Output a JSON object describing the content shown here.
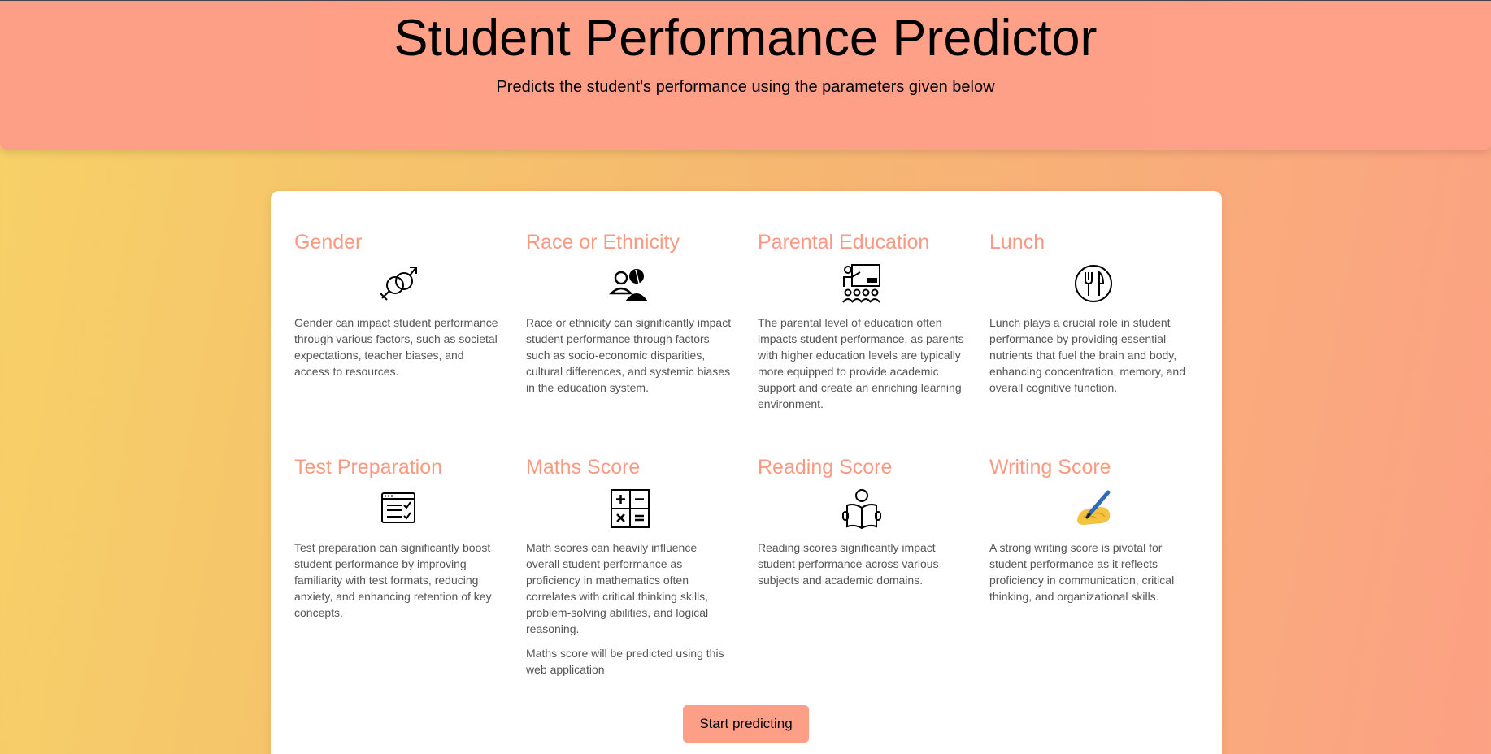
{
  "header": {
    "title": "Student Performance Predictor",
    "subtitle": "Predicts the student's performance using the parameters given below"
  },
  "features": [
    {
      "title": "Gender",
      "icon": "gender-icon",
      "description": "Gender can impact student performance through various factors, such as societal expectations, teacher biases, and access to resources."
    },
    {
      "title": "Race or Ethnicity",
      "icon": "ethnicity-icon",
      "description": "Race or ethnicity can significantly impact student performance through factors such as socio-economic disparities, cultural differences, and systemic biases in the education system."
    },
    {
      "title": "Parental Education",
      "icon": "teacher-icon",
      "description": "The parental level of education often impacts student performance, as parents with higher education levels are typically more equipped to provide academic support and create an enriching learning environment."
    },
    {
      "title": "Lunch",
      "icon": "fork-knife-icon",
      "description": "Lunch plays a crucial role in student performance by providing essential nutrients that fuel the brain and body, enhancing concentration, memory, and overall cognitive function."
    },
    {
      "title": "Test Preparation",
      "icon": "checklist-icon",
      "description": "Test preparation can significantly boost student performance by improving familiarity with test formats, reducing anxiety, and enhancing retention of key concepts."
    },
    {
      "title": "Maths Score",
      "icon": "calculator-icon",
      "description": "Math scores can heavily influence overall student performance as proficiency in mathematics often correlates with critical thinking skills, problem-solving abilities, and logical reasoning.",
      "note": "Maths score will be predicted using this web application"
    },
    {
      "title": "Reading Score",
      "icon": "reading-icon",
      "description": "Reading scores significantly impact student performance across various subjects and academic domains."
    },
    {
      "title": "Writing Score",
      "icon": "writing-hand-icon",
      "description": "A strong writing score is pivotal for student performance as it reflects proficiency in communication, critical thinking, and organizational skills."
    }
  ],
  "action": {
    "start_label": "Start predicting"
  },
  "colors": {
    "accent": "#fd9e86",
    "heading": "#fa9a82",
    "text": "#555555"
  }
}
